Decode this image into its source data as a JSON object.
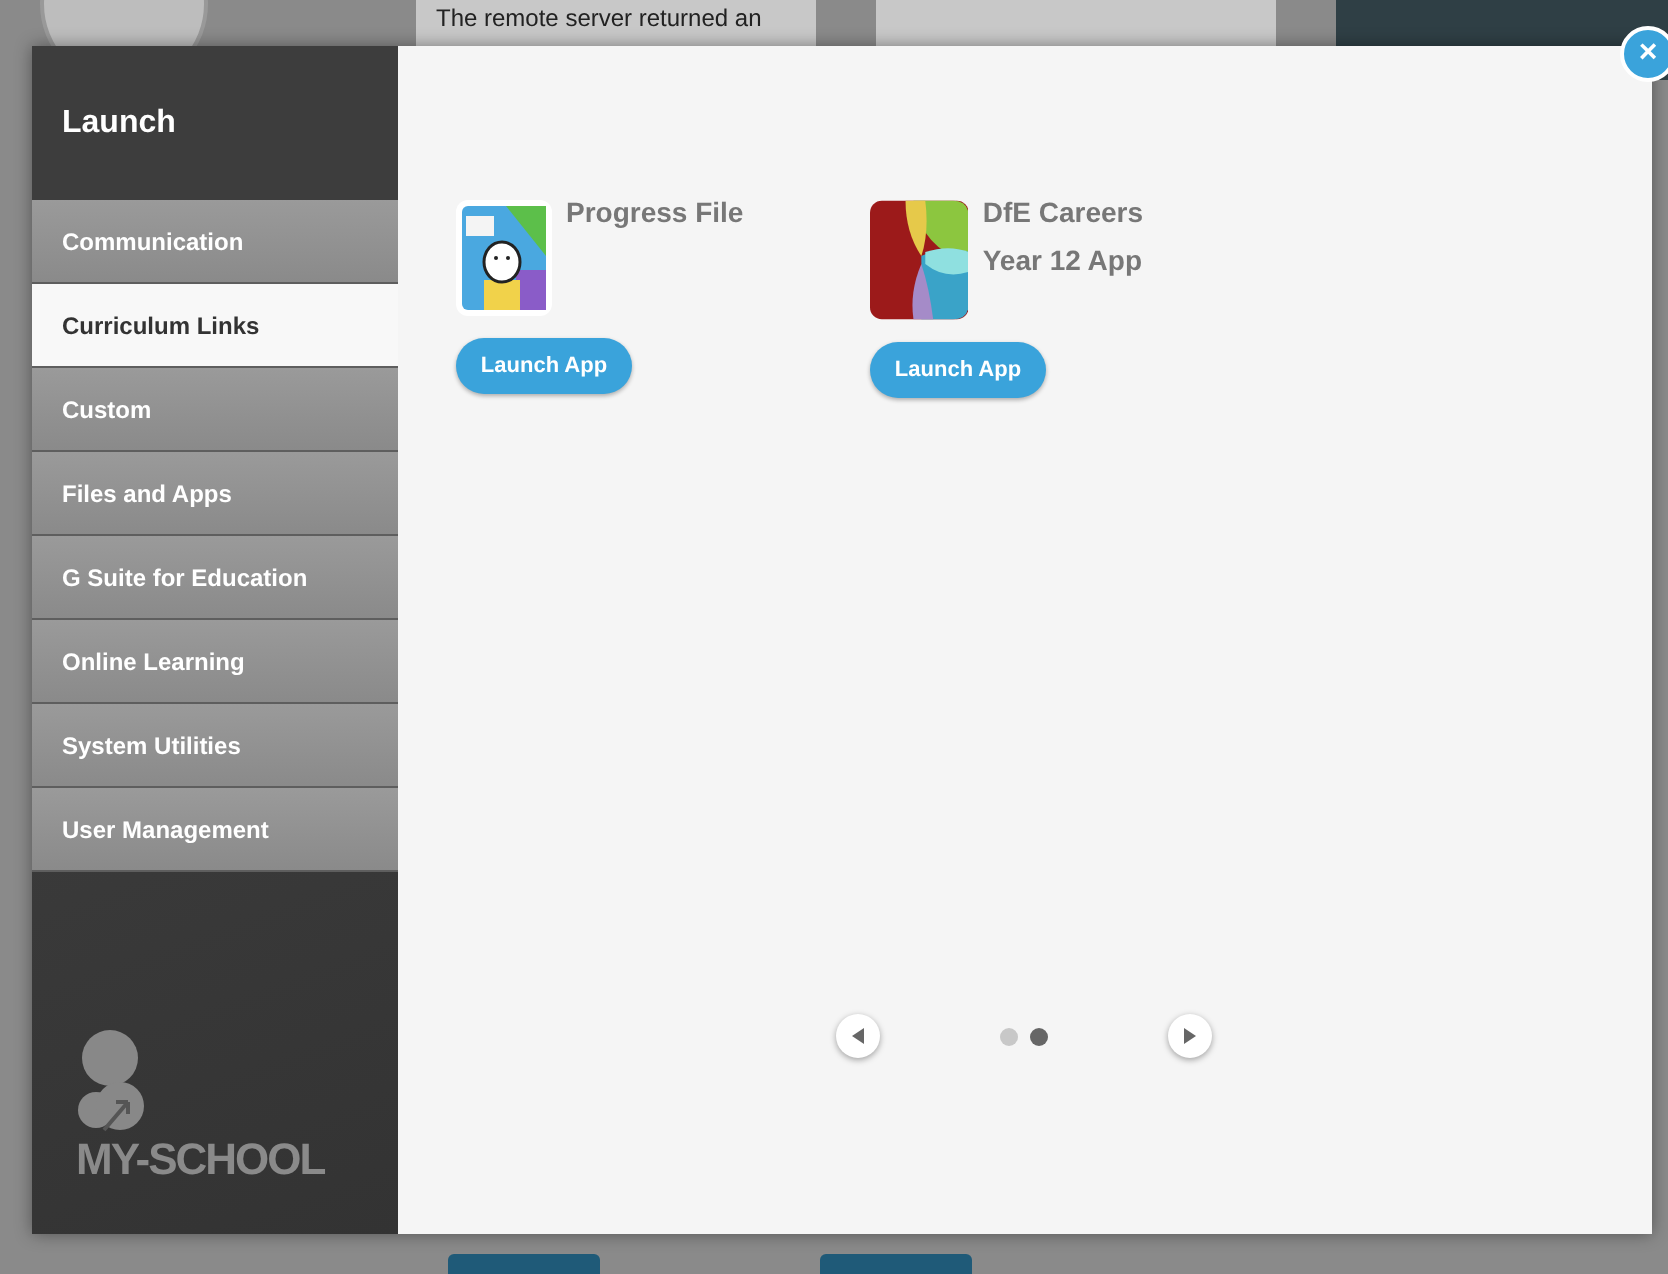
{
  "background": {
    "notice": "The remote server returned an"
  },
  "sidebar": {
    "title": "Launch",
    "items": [
      {
        "label": "Communication",
        "selected": false
      },
      {
        "label": "Curriculum Links",
        "selected": true
      },
      {
        "label": "Custom",
        "selected": false
      },
      {
        "label": "Files and Apps",
        "selected": false
      },
      {
        "label": "G Suite for Education",
        "selected": false
      },
      {
        "label": "Online Learning",
        "selected": false
      },
      {
        "label": "System Utilities",
        "selected": false
      },
      {
        "label": "User Management",
        "selected": false
      }
    ],
    "logo": "MY-SCHOOL"
  },
  "apps": [
    {
      "kind": "progress",
      "name": "Progress File",
      "button": "Launch App"
    },
    {
      "kind": "careers",
      "name": "DfE Careers Year 12 App",
      "button": "Launch App"
    }
  ],
  "pager": {
    "close": "×",
    "pages": [
      {
        "selected": false
      },
      {
        "selected": true
      }
    ]
  }
}
